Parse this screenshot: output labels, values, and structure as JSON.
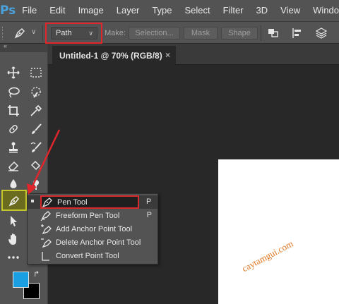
{
  "app": {
    "logo": "Ps",
    "accent_color": "#4aa3df"
  },
  "menubar": {
    "items": [
      "File",
      "Edit",
      "Image",
      "Layer",
      "Type",
      "Select",
      "Filter",
      "3D",
      "View",
      "Window"
    ]
  },
  "options_bar": {
    "tool_icon": "pen-icon",
    "mode_select": {
      "value": "Path"
    },
    "make_label": "Make:",
    "selection_button": "Selection...",
    "mask_button": "Mask",
    "shape_button": "Shape",
    "icons": [
      "path-operations-icon",
      "path-alignment-icon",
      "path-arrangement-icon"
    ],
    "highlight_color": "#e0262b"
  },
  "document": {
    "tab_title": "Untitled-1 @ 70% (RGB/8)",
    "close_glyph": "×"
  },
  "toolbox": {
    "tools": [
      "move-icon",
      "marquee-icon",
      "lasso-icon",
      "quick-selection-icon",
      "crop-icon",
      "eyedropper-icon",
      "healing-brush-icon",
      "brush-icon",
      "clone-stamp-icon",
      "history-brush-icon",
      "eraser-icon",
      "paint-bucket-icon",
      "blur-icon",
      "dodge-icon",
      "pen-icon",
      "path-selection-icon",
      "hand-icon",
      "more-tools-icon"
    ],
    "foreground_color": "#1b9fe3",
    "background_color": "#000000"
  },
  "flyout": {
    "items": [
      {
        "label": "Pen Tool",
        "key": "P",
        "icon": "pen-icon"
      },
      {
        "label": "Freeform Pen Tool",
        "key": "P",
        "icon": "freeform-pen-icon"
      },
      {
        "label": "Add Anchor Point Tool",
        "key": "",
        "icon": "add-anchor-point-icon"
      },
      {
        "label": "Delete Anchor Point Tool",
        "key": "",
        "icon": "delete-anchor-point-icon"
      },
      {
        "label": "Convert Point Tool",
        "key": "",
        "icon": "convert-point-icon"
      }
    ]
  },
  "watermark": {
    "text": "caytamgui.com"
  }
}
